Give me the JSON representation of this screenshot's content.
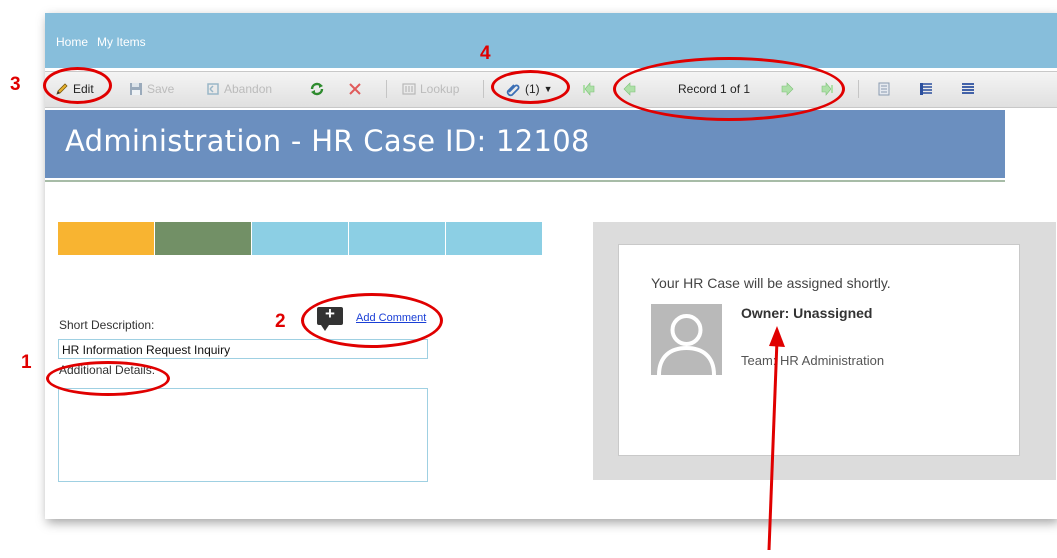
{
  "nav": {
    "home": "Home",
    "my_items": "My Items"
  },
  "toolbar": {
    "edit": "Edit",
    "save": "Save",
    "abandon": "Abandon",
    "lookup": "Lookup",
    "attachments": "(1)",
    "record": "Record 1 of 1"
  },
  "page": {
    "title": "Administration - HR Case ID: 12108"
  },
  "progress_colors": [
    "#f8b431",
    "#729066",
    "#8ccfe4",
    "#8ccfe4",
    "#8ccfe4"
  ],
  "form": {
    "short_description_label": "Short Description:",
    "short_description_value": "HR Information Request Inquiry",
    "additional_details_label": "Additional Details:",
    "additional_details_value": "",
    "add_comment": "Add Comment"
  },
  "assignment": {
    "message": "Your HR Case will be assigned shortly.",
    "owner": "Owner: Unassigned",
    "team": "Team: HR Administration"
  },
  "annotations": [
    "1",
    "2",
    "3",
    "4"
  ],
  "colors": {
    "annotation": "#e00000",
    "nav": "#87bedb",
    "title_bar": "#6b8fbf"
  }
}
